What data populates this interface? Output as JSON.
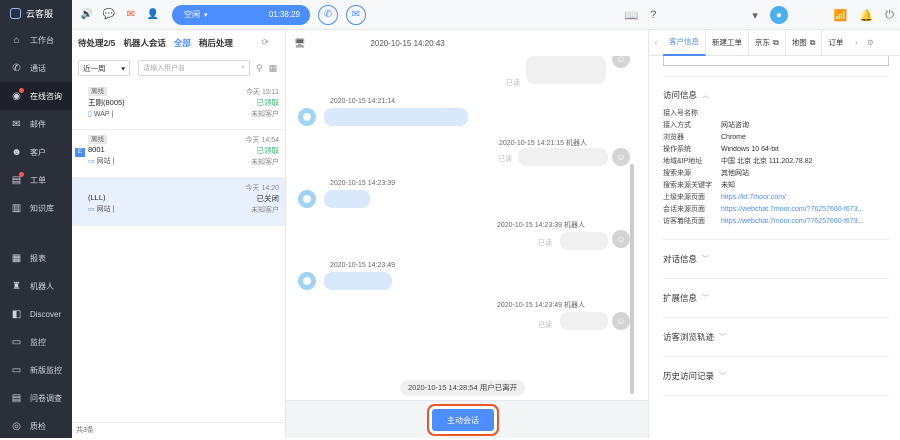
{
  "app": {
    "name": "云客服"
  },
  "sidebar": {
    "items": [
      {
        "label": "工作台",
        "icon": "home-icon"
      },
      {
        "label": "通话",
        "icon": "phone-icon"
      },
      {
        "label": "在线咨询",
        "icon": "chat-icon",
        "active": true,
        "dot": true
      },
      {
        "label": "邮件",
        "icon": "mail-icon"
      },
      {
        "label": "客户",
        "icon": "user-icon"
      },
      {
        "label": "工单",
        "icon": "ticket-icon",
        "dot": true
      },
      {
        "label": "知识库",
        "icon": "book-icon"
      }
    ],
    "items2": [
      {
        "label": "报表",
        "icon": "chart-icon"
      },
      {
        "label": "机器人",
        "icon": "robot-icon"
      },
      {
        "label": "Discover",
        "icon": "discover-icon"
      },
      {
        "label": "监控",
        "icon": "monitor-icon"
      },
      {
        "label": "新版监控",
        "icon": "monitor2-icon"
      },
      {
        "label": "问卷调查",
        "icon": "survey-icon"
      },
      {
        "label": "质检",
        "icon": "quality-icon"
      }
    ]
  },
  "topbar": {
    "status": "空闲",
    "timer": "01:38:29"
  },
  "list": {
    "tabs": {
      "pending": "待处理2/5",
      "robot": "机器人会话",
      "all": "全部",
      "later": "稍后处理"
    },
    "range": "近一周",
    "search_placeholder": "请输入用户名",
    "sessions": [
      {
        "tag": "离线",
        "name": "王刚(8005)",
        "channel": "WAP",
        "time": "今天 15:11",
        "status": "已领取",
        "cust": "未知客户",
        "status_color": "green"
      },
      {
        "tag": "离线",
        "name": "8001",
        "channel": "网站",
        "time": "今天 14:54",
        "status": "已领取",
        "cust": "未知客户",
        "status_color": "green",
        "badge": "E"
      },
      {
        "tag": "",
        "name": "(LLL)",
        "channel": "网站",
        "time": "今天 14:20",
        "status": "已关闭",
        "cust": "未知客户",
        "status_color": "gray"
      }
    ],
    "footer": "共3条"
  },
  "chat": {
    "header_time": "2020-10-15 14:20:43",
    "messages": [
      {
        "side": "right",
        "meta": "",
        "read": "已读"
      },
      {
        "side": "left",
        "meta": "2020-10-15 14:21:14"
      },
      {
        "side": "right",
        "meta": "2020-10-15 14:21:15 机器人",
        "read": "已读"
      },
      {
        "side": "left",
        "meta": "2020-10-15 14:23:39"
      },
      {
        "side": "right",
        "meta": "2020-10-15 14:23:39 机器人",
        "read": "已读"
      },
      {
        "side": "left",
        "meta": "2020-10-15 14:23:49"
      },
      {
        "side": "right",
        "meta": "2020-10-15 14:23:49 机器人",
        "read": "已读"
      }
    ],
    "leave": "2020-10-15 14:28:54 用户已离开",
    "initiate": "主动会话"
  },
  "info": {
    "tabs": [
      "客户信息",
      "新建工单",
      "京东",
      "地图",
      "订单"
    ],
    "visit_title": "访问信息",
    "fields": [
      {
        "k": "接入号名称",
        "v": ""
      },
      {
        "k": "接入方式",
        "v": "网站咨询"
      },
      {
        "k": "浏览器",
        "v": "Chrome"
      },
      {
        "k": "操作系统",
        "v": "Windows 10 64-bit"
      },
      {
        "k": "地域&IP地址",
        "v": "中国 北京 北京 111.202.78.82"
      },
      {
        "k": "搜索来源",
        "v": "其他网站"
      },
      {
        "k": "搜索来源关键字",
        "v": "未知"
      },
      {
        "k": "上级来源页面",
        "v": "https://kf.7moor.com/",
        "link": true
      },
      {
        "k": "会话来源页面",
        "v": "https://webchat.7moor.com/?76257660-f673...",
        "link": true
      },
      {
        "k": "访客着陆页面",
        "v": "https://webchat.7moor.com/?76257660-f673...",
        "link": true
      }
    ],
    "sections": [
      "对话信息",
      "扩展信息",
      "访客浏览轨迹",
      "历史访问记录"
    ]
  },
  "colors": {
    "accent": "#4c8dff",
    "sidebar": "#2b2f3a",
    "highlight": "#e8562a"
  }
}
